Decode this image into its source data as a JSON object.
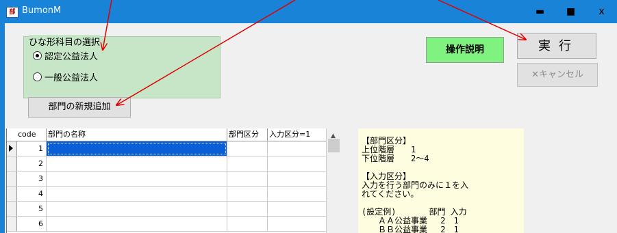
{
  "window": {
    "title": "BumonM",
    "icon_text": "部",
    "minimize_glyph": "▬",
    "maximize_glyph": "■",
    "close_glyph": "x"
  },
  "group": {
    "title": "ひな形科目の選択",
    "options": [
      {
        "label": "認定公益法人",
        "checked": true
      },
      {
        "label": "一般公益法人",
        "checked": false
      }
    ]
  },
  "buttons": {
    "add_bumon": "部門の新規追加",
    "help": "操作説明",
    "execute": "実行",
    "cancel": "キャンセル",
    "cancel_icon": "✕"
  },
  "grid": {
    "columns": [
      "code",
      "部門の名称",
      "部門区分",
      "入力区分=1"
    ],
    "rows": [
      {
        "code": "1",
        "name": "",
        "kubun": "",
        "input": "",
        "selected": true
      },
      {
        "code": "2",
        "name": "",
        "kubun": "",
        "input": ""
      },
      {
        "code": "3",
        "name": "",
        "kubun": "",
        "input": ""
      },
      {
        "code": "4",
        "name": "",
        "kubun": "",
        "input": ""
      },
      {
        "code": "5",
        "name": "",
        "kubun": "",
        "input": ""
      },
      {
        "code": "6",
        "name": "",
        "kubun": "",
        "input": ""
      }
    ],
    "scroll_up_glyph": "▲"
  },
  "note": {
    "lines": [
      "【部門区分】",
      "上位階層　　1",
      "下位階層　　2～4",
      "",
      "【入力区分】",
      "入力を行う部門のみに１を入",
      "れてください。",
      "",
      "(設定例)　　　　部門 入力",
      "　　ＡＡ公益事業　 2　1",
      "　　ＢＢ公益事業　 2　1"
    ]
  },
  "colors": {
    "titlebar": "#1883d7",
    "group_bg": "#c7e5c7",
    "help_button": "#7ff27f",
    "note_bg": "#fffde0",
    "arrow": "#e00000",
    "selected": "#0a5fd6"
  }
}
